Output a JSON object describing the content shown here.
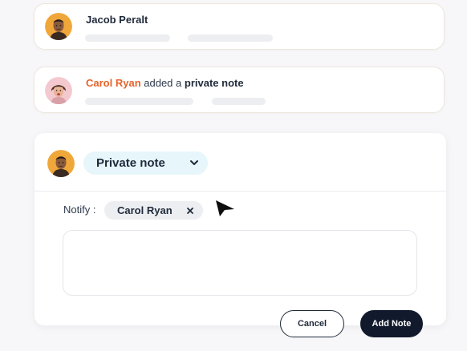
{
  "activity": [
    {
      "name": "Jacob Peralt",
      "action": "",
      "object": ""
    },
    {
      "name": "Carol Ryan",
      "action": "added a",
      "object": "private note"
    }
  ],
  "composer": {
    "note_type": "Private note",
    "notify_label": "Notify :",
    "notify_chips": [
      "Carol Ryan"
    ],
    "note_value": "",
    "note_placeholder": "",
    "cancel_label": "Cancel",
    "add_label": "Add Note"
  },
  "colors": {
    "actor_accent": "#e8622a",
    "note_type_bg": "#e6f6fb",
    "primary_button": "#111a2c"
  },
  "icons": {
    "note_type_toggle": "chevron-down-icon",
    "chip_remove": "close-icon",
    "pointer": "cursor-arrow-icon"
  }
}
